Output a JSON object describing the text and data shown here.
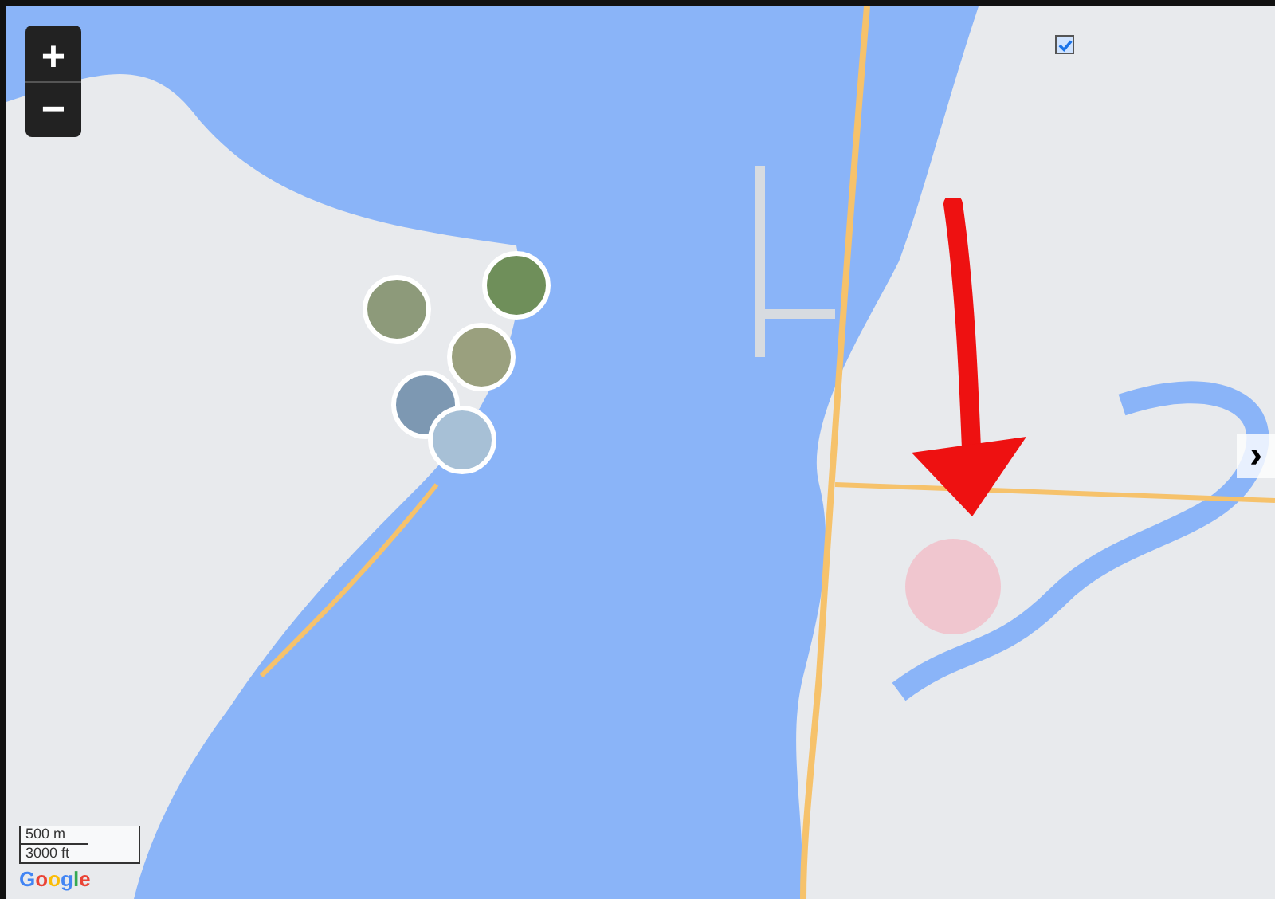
{
  "map": {
    "zoom_controls": [
      {
        "kind": "in",
        "label": "+"
      },
      {
        "kind": "out",
        "label": "−"
      }
    ],
    "landmarks_toggle": {
      "checked": true
    },
    "next_button": {
      "label": "›"
    },
    "scale": {
      "metric": "500 m",
      "imperial": "3000 ft"
    },
    "attribution": "Google"
  }
}
